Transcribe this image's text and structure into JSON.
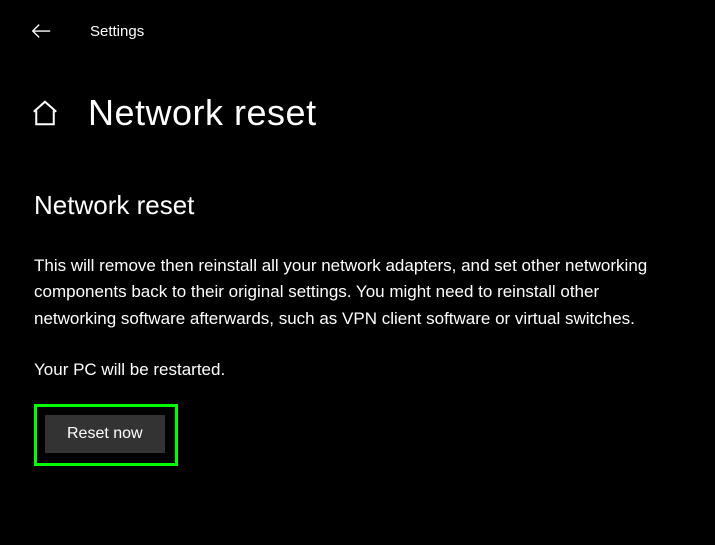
{
  "header": {
    "title": "Settings"
  },
  "page": {
    "title": "Network reset"
  },
  "section": {
    "heading": "Network reset",
    "description": "This will remove then reinstall all your network adapters, and set other networking components back to their original settings. You might need to reinstall other networking software afterwards, such as VPN client software or virtual switches.",
    "restart_note": "Your PC will be restarted."
  },
  "actions": {
    "reset_label": "Reset now"
  }
}
